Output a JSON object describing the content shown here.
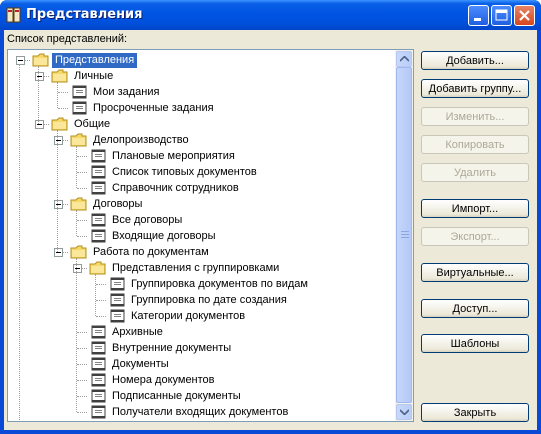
{
  "window": {
    "title": "Представления",
    "list_label": "Список представлений:"
  },
  "tree": [
    {
      "label": "Представления",
      "icon": "folder-icon",
      "level": 0,
      "selected": true
    },
    {
      "label": "Личные",
      "icon": "folder-icon",
      "level": 1
    },
    {
      "label": "Мои задания",
      "icon": "view-icon",
      "level": 2
    },
    {
      "label": "Просроченные задания",
      "icon": "view-icon",
      "level": 2
    },
    {
      "label": "Общие",
      "icon": "folder-icon",
      "level": 1
    },
    {
      "label": "Делопроизводство",
      "icon": "folder-icon",
      "level": 2
    },
    {
      "label": "Плановые мероприятия",
      "icon": "view-icon",
      "level": 3
    },
    {
      "label": "Список типовых документов",
      "icon": "view-icon",
      "level": 3
    },
    {
      "label": "Справочник сотрудников",
      "icon": "view-icon",
      "level": 3
    },
    {
      "label": "Договоры",
      "icon": "folder-icon",
      "level": 2
    },
    {
      "label": "Все договоры",
      "icon": "view-icon",
      "level": 3
    },
    {
      "label": "Входящие договоры",
      "icon": "view-icon",
      "level": 3
    },
    {
      "label": "Работа по документам",
      "icon": "folder-icon",
      "level": 2
    },
    {
      "label": "Представления с группировками",
      "icon": "folder-icon",
      "level": 3
    },
    {
      "label": "Группировка документов по видам",
      "icon": "view-icon",
      "level": 4
    },
    {
      "label": "Группировка по дате создания",
      "icon": "view-icon",
      "level": 4
    },
    {
      "label": "Категории документов",
      "icon": "view-icon",
      "level": 4
    },
    {
      "label": "Архивные",
      "icon": "view-icon",
      "level": 3
    },
    {
      "label": "Внутренние документы",
      "icon": "view-icon",
      "level": 3
    },
    {
      "label": "Документы",
      "icon": "view-icon",
      "level": 3
    },
    {
      "label": "Номера документов",
      "icon": "view-icon",
      "level": 3
    },
    {
      "label": "Подписанные документы",
      "icon": "view-icon",
      "level": 3
    },
    {
      "label": "Получатели входящих документов",
      "icon": "view-icon",
      "level": 3
    }
  ],
  "buttons": {
    "add": "Добавить...",
    "add_group": "Добавить группу...",
    "edit": "Изменить...",
    "copy": "Копировать",
    "delete": "Удалить",
    "import": "Импорт...",
    "export": "Экспорт...",
    "virtual": "Виртуальные...",
    "access": "Доступ...",
    "templates": "Шаблоны",
    "close": "Закрыть"
  },
  "colors": {
    "selection": "#316ac5",
    "titlebar": "#0054e3",
    "folder": "#f6d86b"
  }
}
